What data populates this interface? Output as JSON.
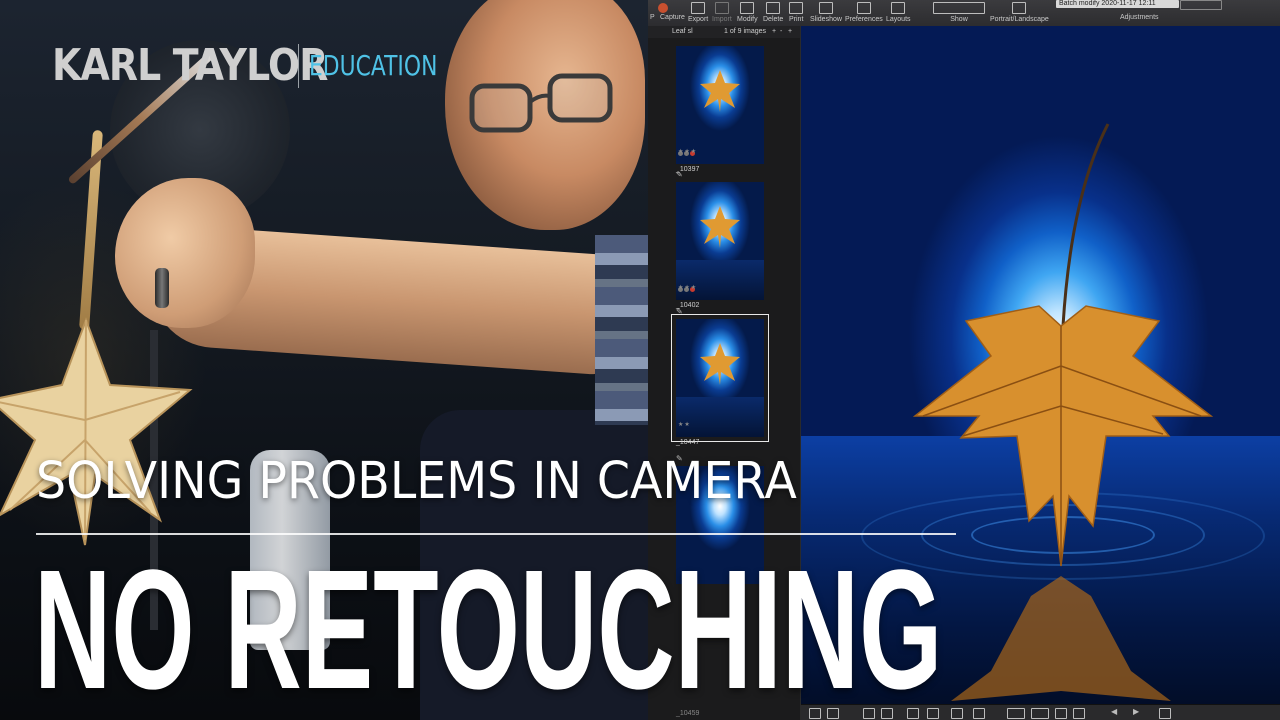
{
  "brand": {
    "name": "KARL TAYLOR",
    "sub": "EDUCATION"
  },
  "headline": "SOLVING PROBLEMS IN CAMERA",
  "title": "NO RETOUCHING",
  "editor": {
    "toolbar": {
      "items": [
        {
          "label": "Capture"
        },
        {
          "label": "Export"
        },
        {
          "label": "Import"
        },
        {
          "label": "Modify"
        },
        {
          "label": "Delete"
        },
        {
          "label": "Print"
        },
        {
          "label": "Slideshow"
        },
        {
          "label": "Preferences"
        },
        {
          "label": "Layouts"
        },
        {
          "label": "Show"
        },
        {
          "label": "Portrait/Landscape"
        },
        {
          "label": "Adjustments"
        }
      ],
      "batch_field": "Batch modify 2020-11-17 12:11",
      "cut_label": "P"
    },
    "browser": {
      "album": "Leaf sl",
      "count": "1 of 9 images",
      "controls": [
        "+",
        "-",
        "+"
      ],
      "thumbs": [
        {
          "name": "_10397",
          "stars": "★★★"
        },
        {
          "name": "_10402",
          "stars": "★★★"
        },
        {
          "name": "_10447",
          "stars": "★★",
          "selected": true
        }
      ],
      "next_partial": "_10459"
    },
    "viewer": {
      "image": "maple-leaf-on-water"
    }
  },
  "colors": {
    "accent": "#4fc2e6",
    "record": "#c8502f",
    "leaf": "#d8902e"
  }
}
